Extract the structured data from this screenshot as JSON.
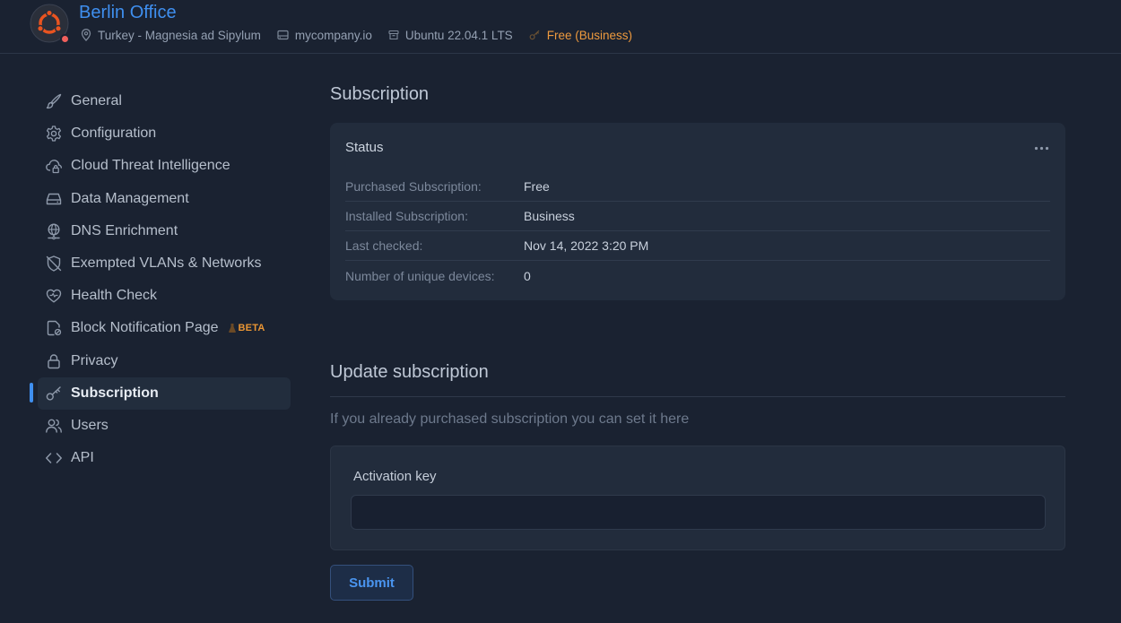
{
  "header": {
    "site_name": "Berlin Office",
    "location": "Turkey - Magnesia ad Sipylum",
    "domain": "mycompany.io",
    "os": "Ubuntu 22.04.1 LTS",
    "plan": "Free (Business)",
    "status_color": "#f0605c",
    "logo_color": "#e95420"
  },
  "sidebar": {
    "items": [
      {
        "label": "General",
        "icon": "brush-icon"
      },
      {
        "label": "Configuration",
        "icon": "gear-icon"
      },
      {
        "label": "Cloud Threat Intelligence",
        "icon": "cloud-lock-icon"
      },
      {
        "label": "Data Management",
        "icon": "hard-drive-icon"
      },
      {
        "label": "DNS Enrichment",
        "icon": "globe-network-icon"
      },
      {
        "label": "Exempted VLANs & Networks",
        "icon": "shield-off-icon"
      },
      {
        "label": "Health Check",
        "icon": "heart-pulse-icon"
      },
      {
        "label": "Block Notification Page",
        "icon": "file-block-icon",
        "badge": "BETA"
      },
      {
        "label": "Privacy",
        "icon": "lock-icon"
      },
      {
        "label": "Subscription",
        "icon": "key-icon",
        "active": true
      },
      {
        "label": "Users",
        "icon": "users-icon"
      },
      {
        "label": "API",
        "icon": "code-icon"
      }
    ]
  },
  "main": {
    "subscription_title": "Subscription",
    "status_card": {
      "title": "Status",
      "rows": [
        {
          "label": "Purchased Subscription:",
          "value": "Free"
        },
        {
          "label": "Installed Subscription:",
          "value": "Business"
        },
        {
          "label": "Last checked:",
          "value": "Nov 14, 2022 3:20 PM"
        },
        {
          "label": "Number of unique devices:",
          "value": "0"
        }
      ]
    },
    "update_title": "Update subscription",
    "update_hint": "If you already purchased subscription you can set it here",
    "activation_key_label": "Activation key",
    "activation_key_value": "",
    "submit_label": "Submit"
  },
  "colors": {
    "accent": "#3f8fef",
    "background": "#1a2231",
    "card": "#222c3c",
    "beta": "#e99534",
    "plan": "#ee9a3e"
  }
}
